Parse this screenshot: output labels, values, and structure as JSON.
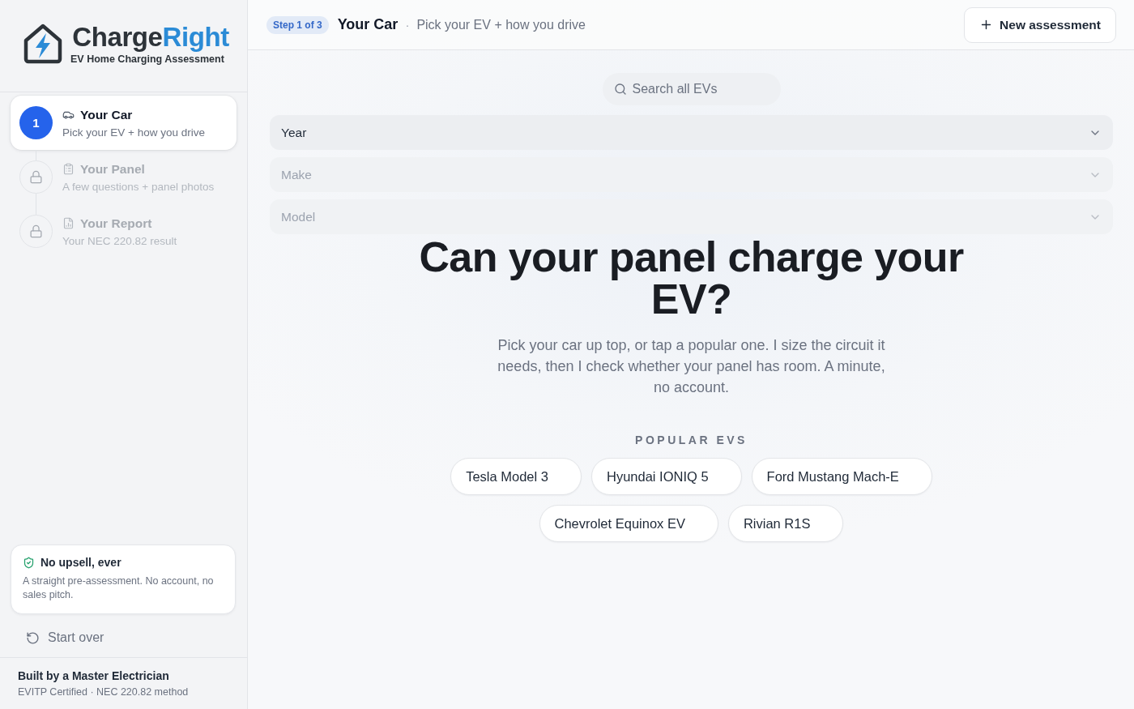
{
  "brand": {
    "name": "Charge",
    "name_accent": "Right",
    "tagline": "EV Home Charging Assessment"
  },
  "steps": [
    {
      "number": "1",
      "title": "Your Car",
      "subtitle": "Pick your EV + how you drive",
      "selected": true,
      "locked": false
    },
    {
      "title": "Your Panel",
      "subtitle": "A few questions + panel photos",
      "selected": false,
      "locked": true
    },
    {
      "title": "Your Report",
      "subtitle": "Your NEC 220.82 result",
      "selected": false,
      "locked": true
    }
  ],
  "notice": {
    "title": "No upsell, ever",
    "body": "A straight pre-assessment. No account, no sales pitch."
  },
  "start_over": {
    "label": "Start over"
  },
  "credit": {
    "title": "Built by a Master Electrician",
    "subtitle": "EVITP Certified · NEC 220.82 method"
  },
  "header": {
    "step_badge": "Step 1 of 3",
    "title": "Your Car",
    "separator": "·",
    "subtitle": "Pick your EV + how you drive",
    "new_button": "New assessment"
  },
  "search": {
    "placeholder": "Search all EVs"
  },
  "selects": [
    {
      "placeholder": "Year",
      "disabled": false
    },
    {
      "placeholder": "Make",
      "disabled": true
    },
    {
      "placeholder": "Model",
      "disabled": true
    }
  ],
  "hero": {
    "title": "Can your panel charge your EV?",
    "body": "Pick your car up top, or tap a popular one. I size the circuit it needs, then I check whether your panel has room. A minute, no account."
  },
  "popular": {
    "heading": "POPULAR EVS",
    "cars": [
      "Tesla Model 3",
      "Hyundai IONIQ 5",
      "Ford Mustang Mach-E",
      "Chevrolet Equinox EV",
      "Rivian R1S"
    ]
  }
}
